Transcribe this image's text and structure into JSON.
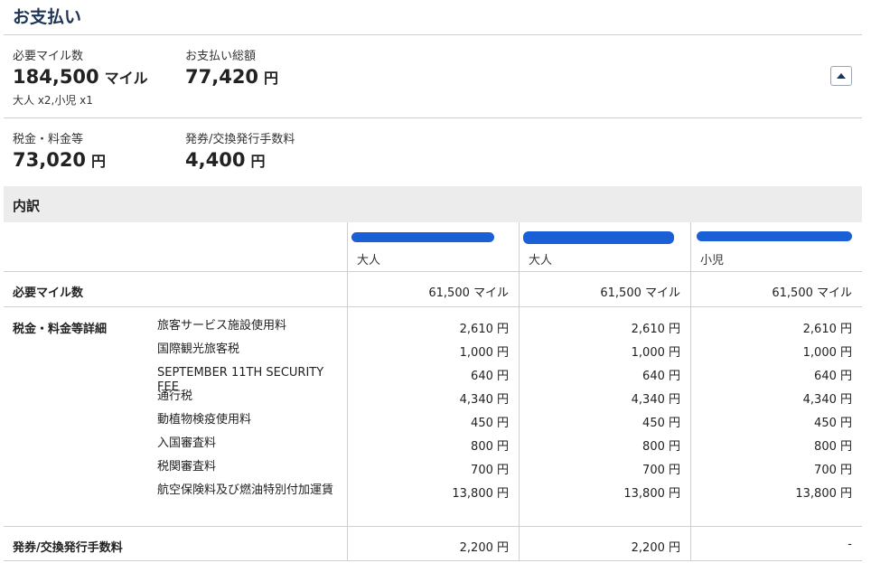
{
  "page_title": "お支払い",
  "summary": {
    "required_miles": {
      "label": "必要マイル数",
      "value": "184,500",
      "unit": "マイル",
      "passengers": "大人 x2,小児 x1"
    },
    "total_payment": {
      "label": "お支払い総額",
      "value": "77,420",
      "unit": "円"
    },
    "taxes_fees": {
      "label": "税金・料金等",
      "value": "73,020",
      "unit": "円"
    },
    "issue_fee": {
      "label": "発券/交換発行手数料",
      "value": "4,400",
      "unit": "円"
    }
  },
  "breakdown": {
    "title": "内訳",
    "passengers": [
      {
        "type": "大人"
      },
      {
        "type": "大人"
      },
      {
        "type": "小児"
      }
    ],
    "required_miles_label": "必要マイル数",
    "required_miles": [
      "61,500 マイル",
      "61,500 マイル",
      "61,500 マイル"
    ],
    "tax_detail_label": "税金・料金等詳細",
    "tax_items": [
      {
        "name": "旅客サービス施設使用料",
        "values": [
          "2,610 円",
          "2,610 円",
          "2,610 円"
        ]
      },
      {
        "name": "国際観光旅客税",
        "values": [
          "1,000 円",
          "1,000 円",
          "1,000 円"
        ]
      },
      {
        "name": "SEPTEMBER 11TH SECURITY FEE",
        "values": [
          "640 円",
          "640 円",
          "640 円"
        ]
      },
      {
        "name": "通行税",
        "values": [
          "4,340 円",
          "4,340 円",
          "4,340 円"
        ]
      },
      {
        "name": "動植物検疫使用料",
        "values": [
          "450 円",
          "450 円",
          "450 円"
        ]
      },
      {
        "name": "入国審査料",
        "values": [
          "800 円",
          "800 円",
          "800 円"
        ]
      },
      {
        "name": "税関審査料",
        "values": [
          "700 円",
          "700 円",
          "700 円"
        ]
      },
      {
        "name": "航空保険料及び燃油特別付加運賃",
        "values": [
          "13,800 円",
          "13,800 円",
          "13,800 円"
        ]
      }
    ],
    "issue_fee_label": "発券/交換発行手数料",
    "issue_fee": [
      "2,200 円",
      "2,200 円",
      "-"
    ]
  },
  "colors": {
    "title": "#1d3557",
    "redaction": "#1a5fd6",
    "band": "#ececec"
  },
  "icons": {
    "collapse": "chevron-up-icon"
  }
}
